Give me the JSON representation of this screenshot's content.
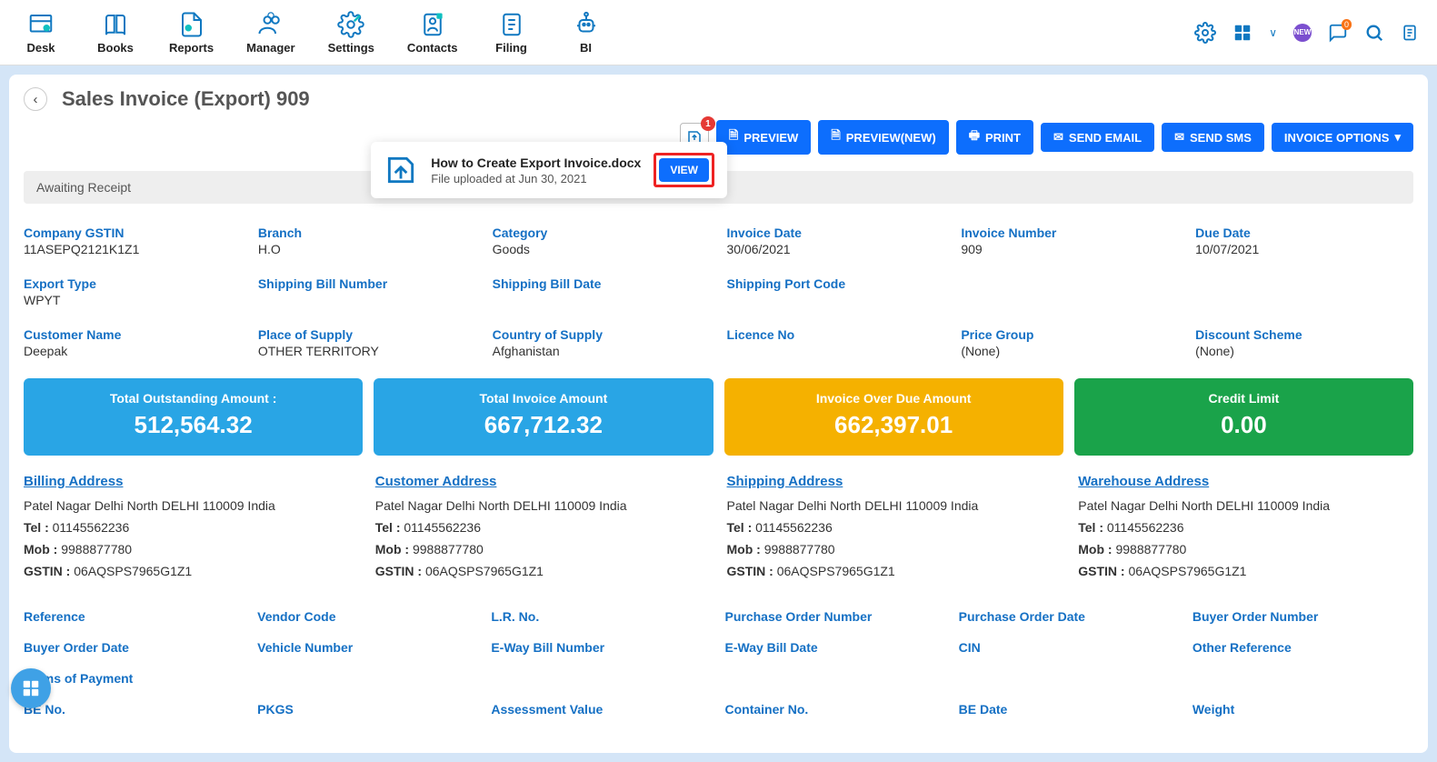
{
  "nav": [
    {
      "label": "Desk"
    },
    {
      "label": "Books"
    },
    {
      "label": "Reports"
    },
    {
      "label": "Manager"
    },
    {
      "label": "Settings"
    },
    {
      "label": "Contacts"
    },
    {
      "label": "Filing"
    },
    {
      "label": "BI"
    }
  ],
  "topRight": {
    "newBadge": "NEW",
    "msgCount": "0"
  },
  "page": {
    "title": "Sales Invoice (Export) 909",
    "uploadNotif": "1"
  },
  "filePopup": {
    "name": "How to Create Export Invoice.docx",
    "sub": "File uploaded at Jun 30, 2021",
    "viewLabel": "VIEW"
  },
  "actions": {
    "preview": "PREVIEW",
    "previewNew": "PREVIEW(NEW)",
    "print": "PRINT",
    "sendEmail": "SEND EMAIL",
    "sendSms": "SEND SMS",
    "invoiceOptions": "INVOICE OPTIONS"
  },
  "status": "Awaiting Receipt",
  "details": [
    {
      "k": "Company GSTIN",
      "v": "11ASEPQ2121K1Z1"
    },
    {
      "k": "Branch",
      "v": "H.O"
    },
    {
      "k": "Category",
      "v": "Goods"
    },
    {
      "k": "Invoice Date",
      "v": "30/06/2021"
    },
    {
      "k": "Invoice Number",
      "v": "909"
    },
    {
      "k": "Due Date",
      "v": "10/07/2021"
    },
    {
      "k": "Export Type",
      "v": "WPYT"
    },
    {
      "k": "Shipping Bill Number",
      "v": ""
    },
    {
      "k": "Shipping Bill Date",
      "v": ""
    },
    {
      "k": "Shipping Port Code",
      "v": ""
    },
    {
      "k": "",
      "v": ""
    },
    {
      "k": "",
      "v": ""
    },
    {
      "k": "Customer Name",
      "v": "Deepak"
    },
    {
      "k": "Place of Supply",
      "v": "OTHER TERRITORY"
    },
    {
      "k": "Country of Supply",
      "v": "Afghanistan"
    },
    {
      "k": "Licence No",
      "v": ""
    },
    {
      "k": "Price Group",
      "v": "(None)"
    },
    {
      "k": "Discount Scheme",
      "v": "(None)"
    }
  ],
  "summary": [
    {
      "title": "Total Outstanding Amount :",
      "value": "512,564.32",
      "cls": "c-blue"
    },
    {
      "title": "Total Invoice Amount",
      "value": "667,712.32",
      "cls": "c-blue"
    },
    {
      "title": "Invoice Over Due Amount",
      "value": "662,397.01",
      "cls": "c-yellow"
    },
    {
      "title": "Credit Limit",
      "value": "0.00",
      "cls": "c-green"
    }
  ],
  "addresses": [
    {
      "title": "Billing Address",
      "addr": "Patel Nagar Delhi North DELHI 110009 India",
      "tel": "01145562236",
      "mob": "9988877780",
      "gstin": "06AQSPS7965G1Z1"
    },
    {
      "title": "Customer Address",
      "addr": "Patel Nagar Delhi North DELHI 110009 India",
      "tel": "01145562236",
      "mob": "9988877780",
      "gstin": "06AQSPS7965G1Z1"
    },
    {
      "title": "Shipping Address",
      "addr": "Patel Nagar Delhi North DELHI 110009 India",
      "tel": "01145562236",
      "mob": "9988877780",
      "gstin": "06AQSPS7965G1Z1"
    },
    {
      "title": "Warehouse Address",
      "addr": "Patel Nagar Delhi North DELHI 110009 India",
      "tel": "01145562236",
      "mob": "9988877780",
      "gstin": "06AQSPS7965G1Z1"
    }
  ],
  "addrLabels": {
    "tel": "Tel :",
    "mob": "Mob :",
    "gstin": "GSTIN :"
  },
  "refs": [
    "Reference",
    "Vendor Code",
    "L.R. No.",
    "Purchase Order Number",
    "Purchase Order Date",
    "Buyer Order Number",
    "Buyer Order Date",
    "Vehicle Number",
    "E-Way Bill Number",
    "E-Way Bill Date",
    "CIN",
    "Other Reference",
    "Terms of Payment",
    "",
    "",
    "",
    "",
    "",
    "BE No.",
    "PKGS",
    "Assessment Value",
    "Container No.",
    "BE Date",
    "Weight"
  ]
}
